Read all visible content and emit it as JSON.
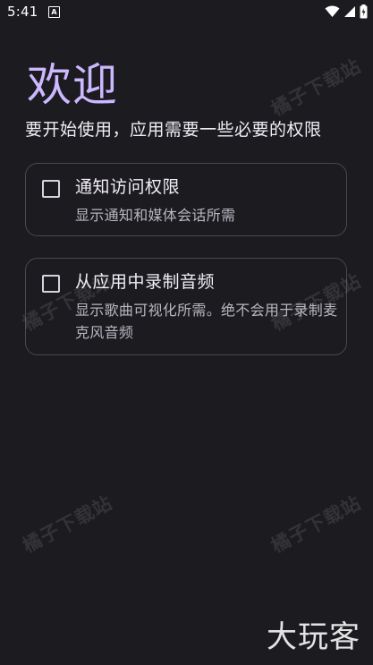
{
  "status_bar": {
    "time": "5:41",
    "app_icon_letter": "A",
    "icons": [
      "app-notification-icon",
      "wifi-icon",
      "cellular-signal-icon",
      "battery-charging-icon"
    ]
  },
  "title": "欢迎",
  "subtitle": "要开始使用，应用需要一些必要的权限",
  "permissions": [
    {
      "title": "通知访问权限",
      "description": "显示通知和媒体会话所需",
      "checked": false
    },
    {
      "title": "从应用中录制音频",
      "description": "显示歌曲可视化所需。绝不会用于录制麦克风音频",
      "checked": false
    }
  ],
  "watermarks": [
    "橘子下载站",
    "橘子下载站",
    "橘子下载站",
    "橘子下载站",
    "橘子下载站"
  ],
  "brand_logo": "大玩客",
  "colors": {
    "background": "#1c1b20",
    "title_accent": "#cbb8ff",
    "card_border": "#4a4850"
  }
}
